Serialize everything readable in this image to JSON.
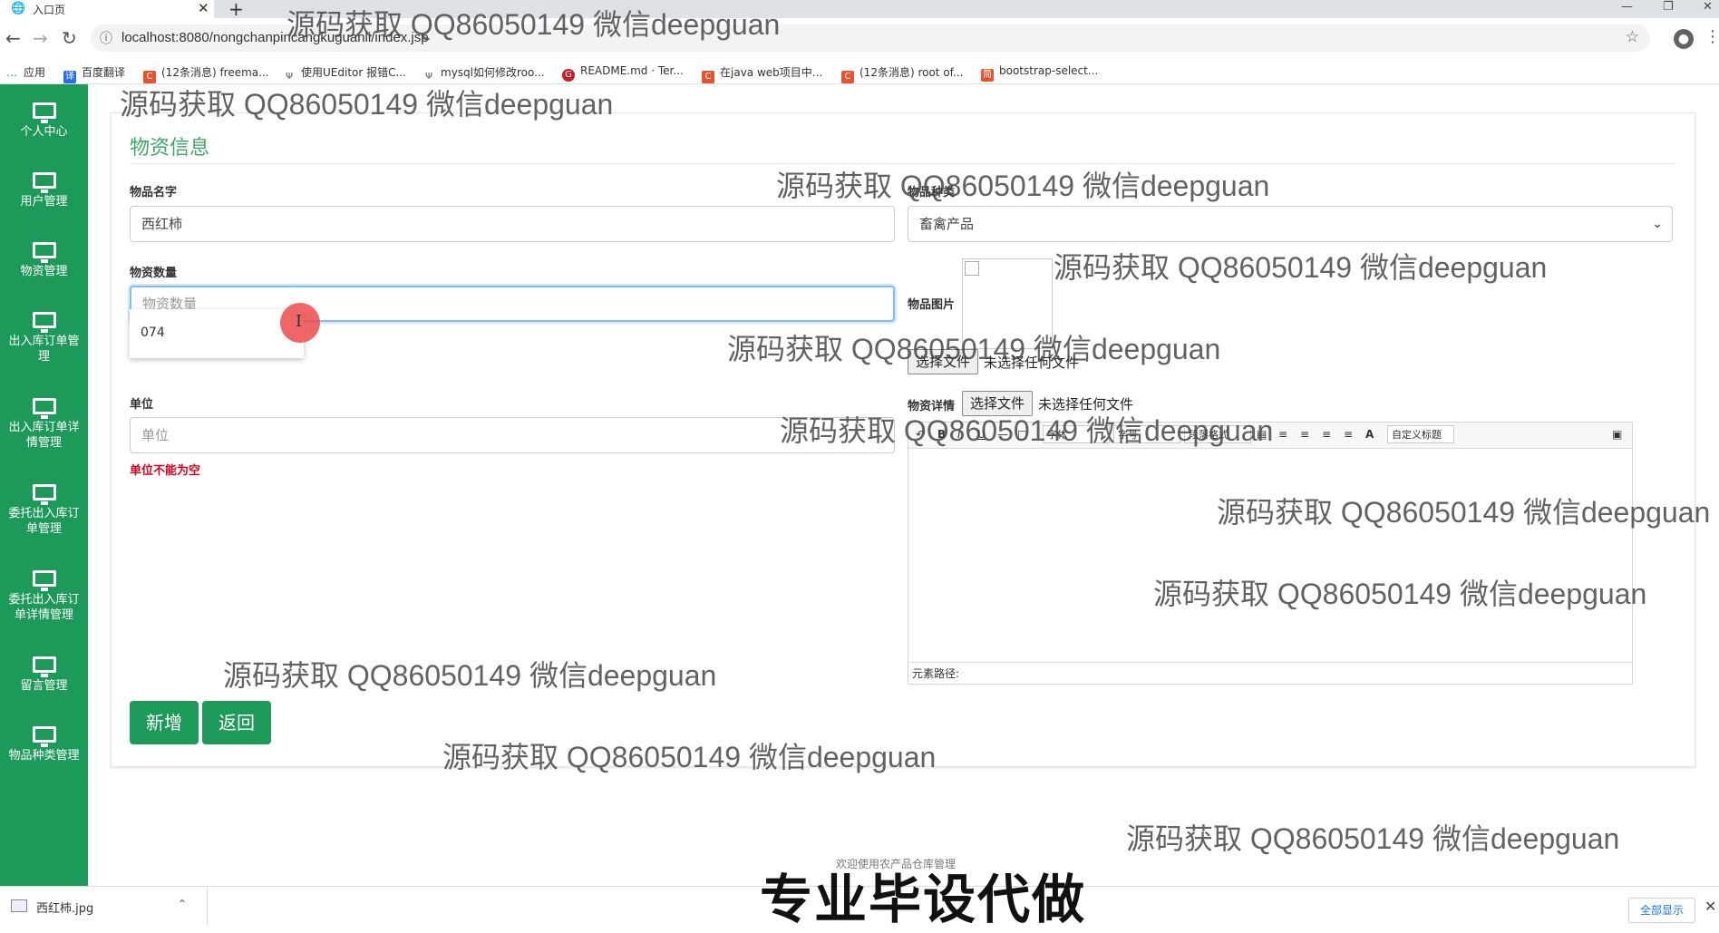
{
  "browser": {
    "tab_title": "入口页",
    "url": "localhost:8080/nongchanpincangkuguanli/index.jsp",
    "bookmarks": [
      {
        "label": "应用",
        "icon": "apps-grid-icon",
        "color": "#1a73e8"
      },
      {
        "label": "百度翻译",
        "icon": "baidu-translate-icon",
        "color": "#2b6de8"
      },
      {
        "label": "(12条消息) freema...",
        "icon": "csdn-icon",
        "color": "#e5532f"
      },
      {
        "label": "使用UEditor 报错C...",
        "icon": "link-icon",
        "color": "#555555"
      },
      {
        "label": "mysql如何修改roo...",
        "icon": "link-icon",
        "color": "#555555"
      },
      {
        "label": "README.md · Ter...",
        "icon": "gitee-icon",
        "color": "#c71d23"
      },
      {
        "label": "在java web项目中...",
        "icon": "csdn-icon",
        "color": "#e5532f"
      },
      {
        "label": "(12条消息) root of...",
        "icon": "csdn-icon",
        "color": "#e5532f"
      },
      {
        "label": "bootstrap-select...",
        "icon": "jianshu-icon",
        "color": "#e5532f"
      }
    ]
  },
  "sidebar": {
    "items": [
      {
        "label": "个人中心"
      },
      {
        "label": "用户管理"
      },
      {
        "label": "物资管理"
      },
      {
        "label": "出入库订单管\n理"
      },
      {
        "label": "出入库订单详\n情管理"
      },
      {
        "label": "委托出入库订\n单管理"
      },
      {
        "label": "委托出入库订\n单详情管理"
      },
      {
        "label": "留言管理"
      },
      {
        "label": "物品种类管理"
      }
    ]
  },
  "form": {
    "title": "物资信息",
    "name_label": "物品名字",
    "name_value": "西红柿",
    "category_label": "物品种类",
    "category_value": "畜禽产品",
    "quantity_label": "物资数量",
    "quantity_placeholder": "物资数量",
    "autocomplete_option": "074",
    "image_label": "物品图片",
    "file_button": "选择文件",
    "no_file_text": "未选择任何文件",
    "unit_label": "单位",
    "unit_placeholder": "单位",
    "unit_error": "单位不能为空",
    "detail_label": "物资详情",
    "editor": {
      "font_family": "字体",
      "font_size": "字号",
      "paragraph": "段落格式",
      "custom_title": "自定义标题",
      "status_path": "元素路径:"
    },
    "add_button": "新增",
    "back_button": "返回"
  },
  "footer_text": "欢迎使用农产品仓库管理",
  "downloads": {
    "file_name": "西红柿.jpg",
    "show_all": "全部显示"
  },
  "overlay": {
    "watermark": "源码获取 QQ86050149 微信deepguan",
    "banner": "专业毕设代做"
  },
  "colors": {
    "sidebar": "#1d9a5a",
    "accent": "#3fa66a",
    "error": "#d9001b"
  }
}
